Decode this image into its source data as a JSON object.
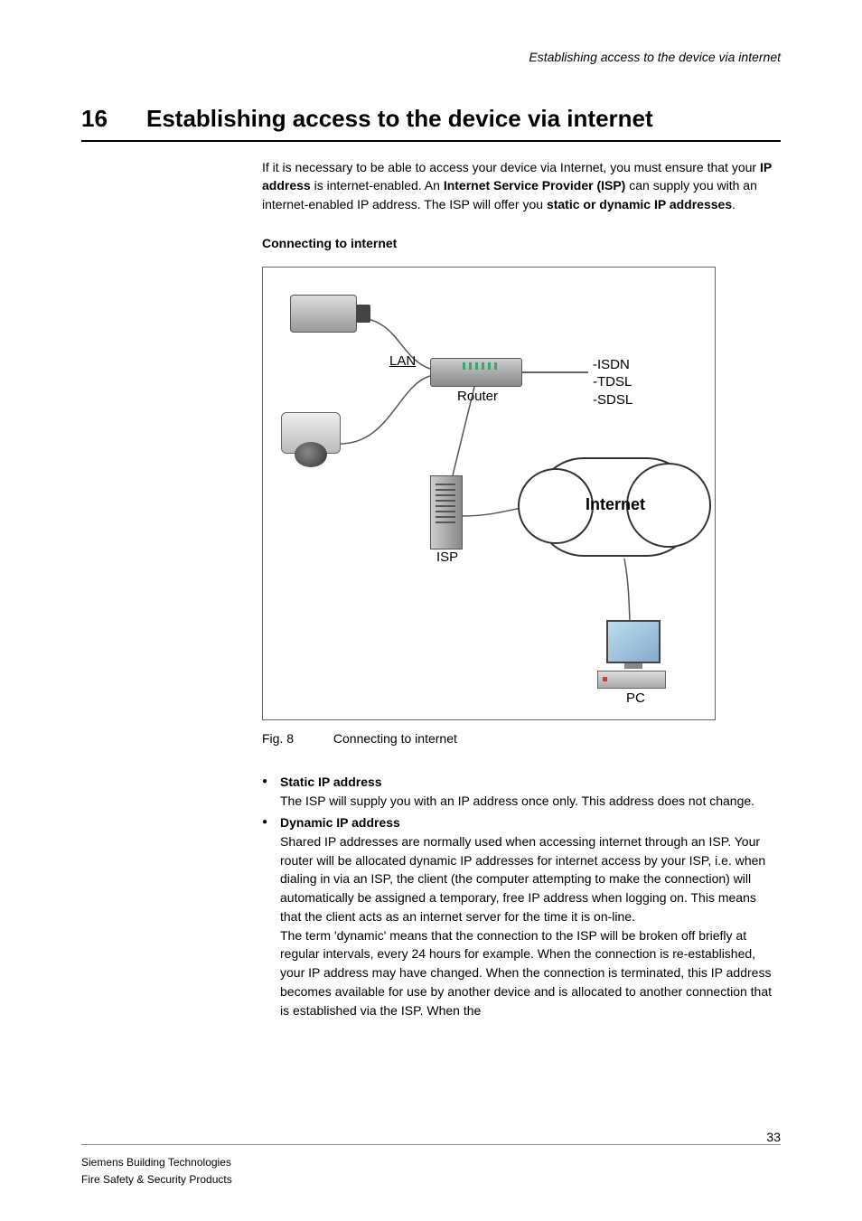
{
  "running_header": "Establishing access to the device via internet",
  "chapter": {
    "number": "16",
    "title": "Establishing access to the device via internet"
  },
  "intro_segments": [
    {
      "t": "If it is necessary to be able to access your device via Internet, you must ensure that your "
    },
    {
      "t": "IP address",
      "b": true
    },
    {
      "t": " is internet-enabled. An "
    },
    {
      "t": "Internet Service Provider (ISP)",
      "b": true
    },
    {
      "t": " can supply you with an internet-enabled IP address. The ISP will offer you "
    },
    {
      "t": "static or dynamic IP addresses",
      "b": true
    },
    {
      "t": "."
    }
  ],
  "subhead": "Connecting to internet",
  "figure": {
    "labels": {
      "lan": "LAN",
      "router": "Router",
      "isp": "ISP",
      "internet": "Internet",
      "pc": "PC",
      "conn_types": "-ISDN\n-TDSL\n-SDSL"
    },
    "caption_num": "Fig. 8",
    "caption_text": "Connecting to internet"
  },
  "bullets": [
    {
      "title": "Static IP address",
      "paragraphs": [
        "The ISP will supply you with an IP address once only. This address does not change."
      ]
    },
    {
      "title": "Dynamic IP address",
      "paragraphs": [
        "Shared IP addresses are normally used when accessing internet through an ISP. Your router will be allocated dynamic IP addresses for internet access by your ISP, i.e. when dialing in via an ISP, the client (the computer attempting to make the connection) will automatically be assigned a temporary, free IP address when logging on. This means that the client acts as an internet server for the time it is on-line.",
        "The term 'dynamic' means that the connection to the ISP will be broken off briefly at regular intervals, every 24 hours for example. When the connection is re-established, your IP address may have changed. When the connection is terminated, this IP address becomes available for use by another device and is allocated to another connection that is established via the ISP. When the"
      ]
    }
  ],
  "page_number": "33",
  "footer": {
    "line1": "Siemens Building Technologies",
    "line2": "Fire Safety & Security Products"
  }
}
